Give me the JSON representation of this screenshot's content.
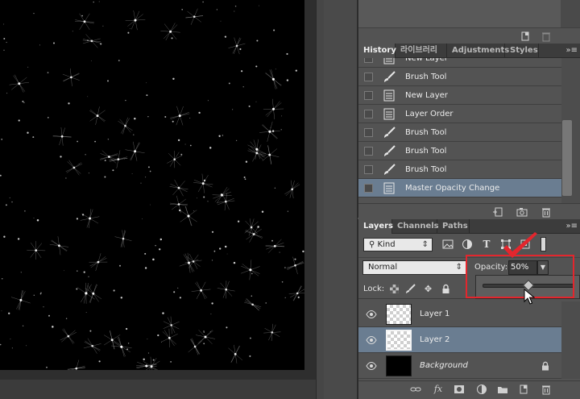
{
  "app": {
    "accent": "#6a7d91",
    "highlight_color": "#e3262d"
  },
  "canvas": {
    "content": "starfield-image"
  },
  "history": {
    "tabs": [
      {
        "label": "History",
        "active": true
      },
      {
        "label": "라이브러리",
        "active": false
      },
      {
        "label": "Adjustments",
        "active": false
      },
      {
        "label": "Styles",
        "active": false
      }
    ],
    "items": [
      {
        "label": "New Layer",
        "icon": "document-icon",
        "selected": false
      },
      {
        "label": "Brush Tool",
        "icon": "brush-icon",
        "selected": false
      },
      {
        "label": "New Layer",
        "icon": "document-icon",
        "selected": false
      },
      {
        "label": "Layer Order",
        "icon": "document-icon",
        "selected": false
      },
      {
        "label": "Brush Tool",
        "icon": "brush-icon",
        "selected": false
      },
      {
        "label": "Brush Tool",
        "icon": "brush-icon",
        "selected": false
      },
      {
        "label": "Brush Tool",
        "icon": "brush-icon",
        "selected": false
      },
      {
        "label": "Master Opacity Change",
        "icon": "document-icon",
        "selected": true
      }
    ],
    "footer_icons": [
      "new-document-from-state-icon",
      "camera-snapshot-icon",
      "trash-icon"
    ]
  },
  "layers": {
    "tabs": [
      {
        "label": "Layers",
        "active": true
      },
      {
        "label": "Channels",
        "active": false
      },
      {
        "label": "Paths",
        "active": false
      }
    ],
    "filter": {
      "kind_label": "Kind",
      "icons": [
        "image-filter-icon",
        "adjustment-filter-icon",
        "type-filter-icon",
        "shape-filter-icon",
        "smart-object-filter-icon"
      ]
    },
    "blend_mode": "Normal",
    "opacity_label": "Opacity:",
    "opacity_value": "50%",
    "opacity_fraction": 0.5,
    "lock_label": "Lock:",
    "items": [
      {
        "name": "Layer 1",
        "thumb": "transparent",
        "selected": false,
        "italic": false,
        "locked": false
      },
      {
        "name": "Layer 2",
        "thumb": "transparent",
        "selected": true,
        "italic": false,
        "locked": false
      },
      {
        "name": "Background",
        "thumb": "black",
        "selected": false,
        "italic": true,
        "locked": true
      }
    ],
    "footer_icons": [
      "link-icon",
      "fx-icon",
      "mask-icon",
      "adjustment-icon",
      "folder-icon",
      "new-layer-icon",
      "trash-icon"
    ]
  }
}
